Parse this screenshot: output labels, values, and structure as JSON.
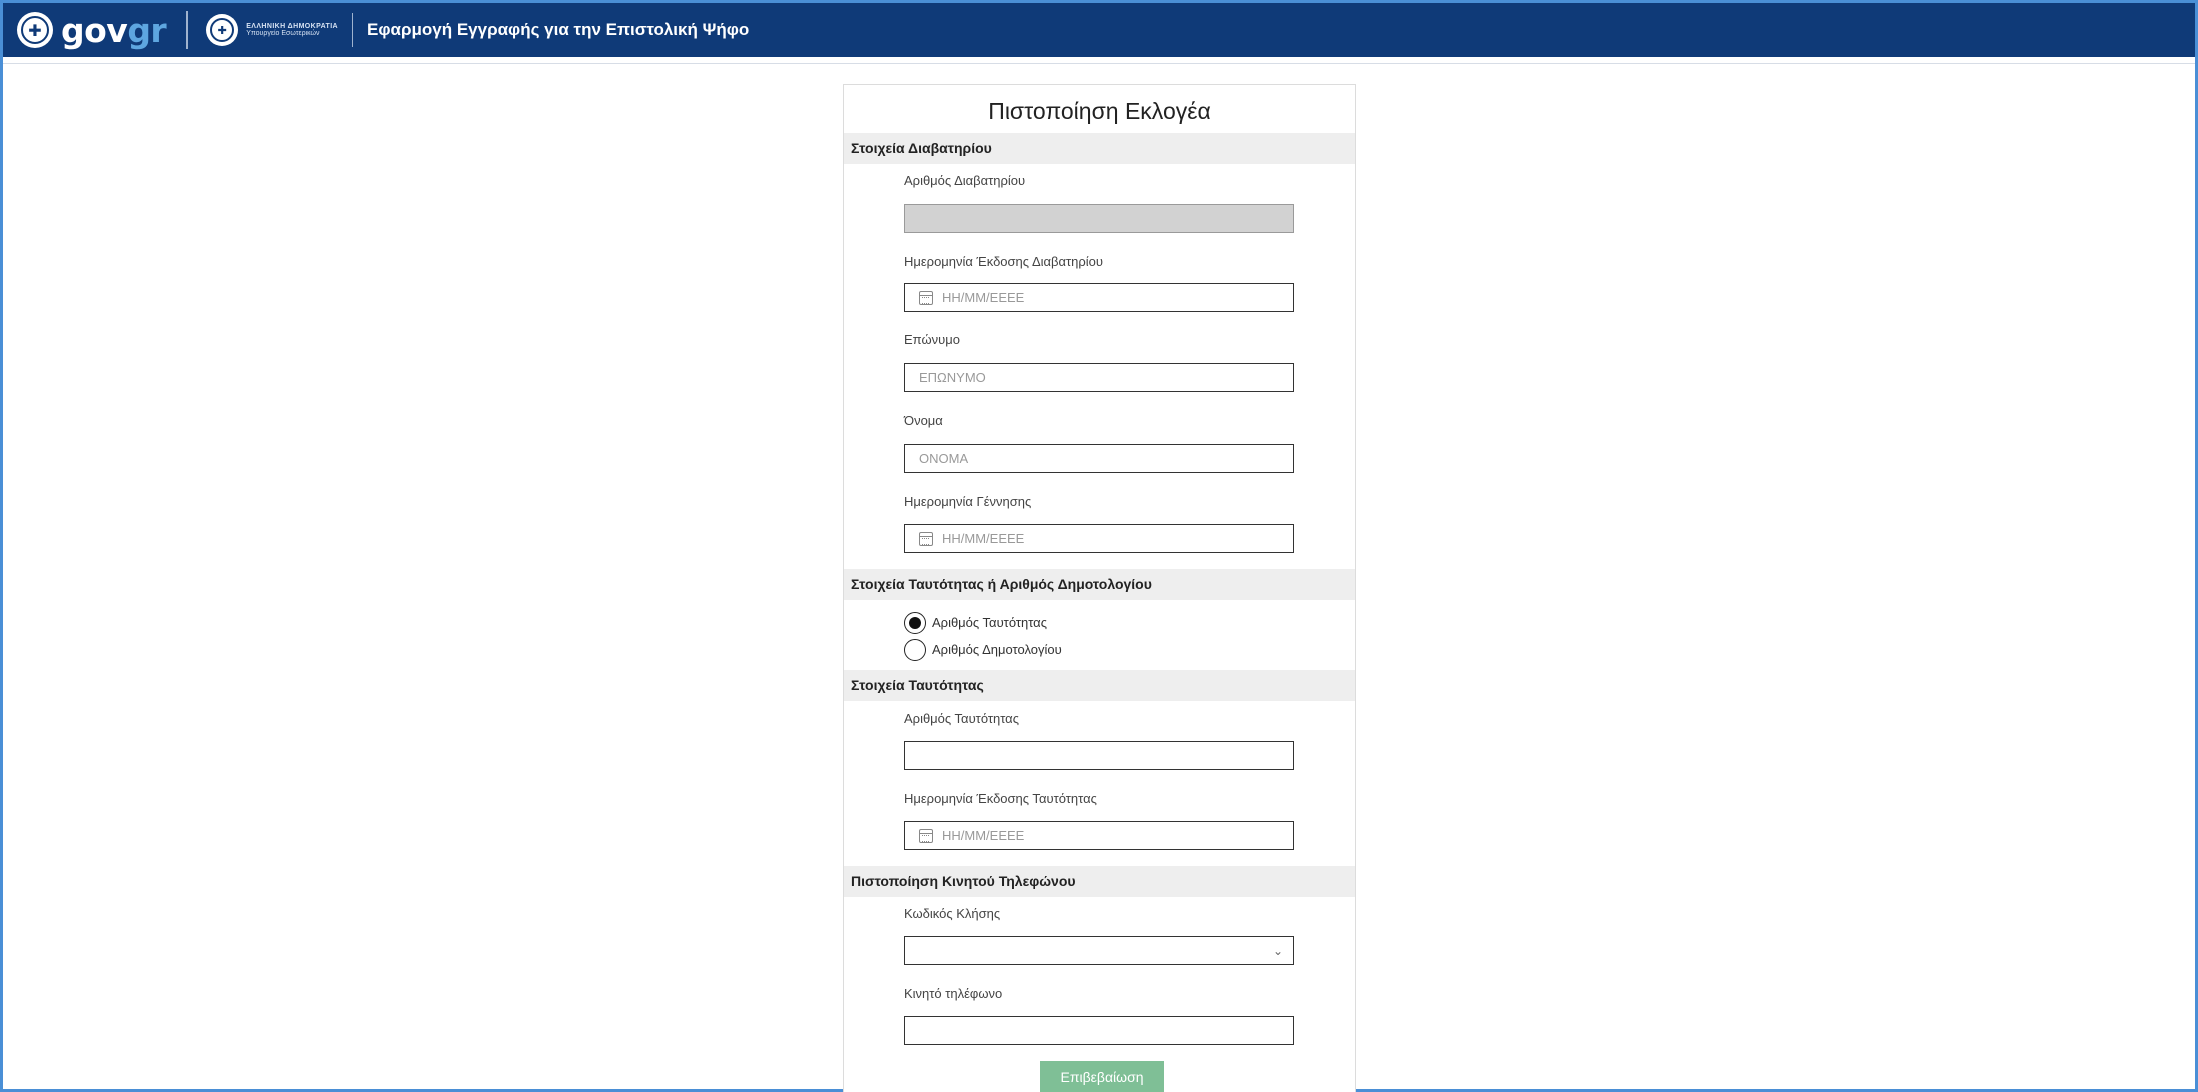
{
  "header": {
    "brand_gov": "gov",
    "brand_gr": "gr",
    "ministry_line1": "ΕΛΛΗΝΙΚΗ ΔΗΜΟΚΡΑΤΙΑ",
    "ministry_line2": "Υπουργείο Εσωτερικών",
    "app_title": "Εφαρμογή Εγγραφής για την Επιστολική Ψήφο",
    "bg_color": "#0f3a78"
  },
  "form": {
    "title": "Πιστοποίηση Εκλογέα",
    "passport": {
      "section_title": "Στοιχεία Διαβατηρίου",
      "number_label": "Αριθμός Διαβατηρίου",
      "number_value": "",
      "issue_date_label": "Ημερομηνία Έκδοσης Διαβατηρίου",
      "issue_date_placeholder": "ΗΗ/ΜΜ/ΕΕΕΕ",
      "surname_label": "Επώνυμο",
      "surname_placeholder": "ΕΠΩΝΥΜΟ",
      "name_label": "Όνομα",
      "name_placeholder": "ΟΝΟΜΑ",
      "birth_date_label": "Ημερομηνία Γέννησης",
      "birth_date_placeholder": "ΗΗ/ΜΜ/ΕΕΕΕ"
    },
    "id_choice": {
      "section_title": "Στοιχεία Ταυτότητας ή Αριθμός Δημοτολογίου",
      "option_id": "Αριθμός Ταυτότητας",
      "option_registry": "Αριθμός Δημοτολογίου",
      "selected": "Αριθμός Ταυτότητας"
    },
    "id_card": {
      "section_title": "Στοιχεία Ταυτότητας",
      "number_label": "Αριθμός Ταυτότητας",
      "number_value": "",
      "issue_date_label": "Ημερομηνία Έκδοσης Ταυτότητας",
      "issue_date_placeholder": "ΗΗ/ΜΜ/ΕΕΕΕ"
    },
    "phone": {
      "section_title": "Πιστοποίηση Κινητού Τηλεφώνου",
      "code_label": "Κωδικός Κλήσης",
      "code_value": "",
      "mobile_label": "Κινητό τηλέφωνο",
      "mobile_value": ""
    },
    "submit_label": "Επιβεβαίωση",
    "submit_color": "#7fbf96"
  }
}
